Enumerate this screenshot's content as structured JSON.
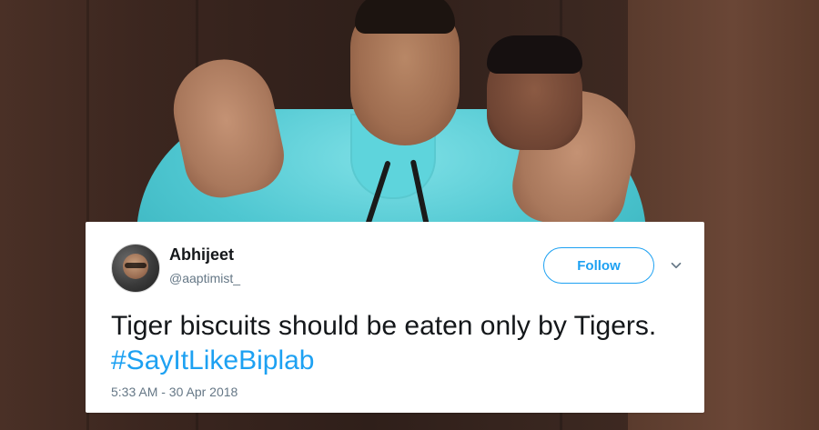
{
  "tweet": {
    "author_name": "Abhijeet",
    "author_handle": "@aaptimist_",
    "follow_label": "Follow",
    "text": "Tiger biscuits should be eaten only by Tigers.",
    "hashtag": "#SayItLikeBiplab",
    "timestamp": "5:33 AM - 30 Apr 2018"
  },
  "colors": {
    "twitter_blue": "#1da1f2",
    "text_dark": "#14171a",
    "text_gray": "#657786"
  },
  "icons": {
    "avatar": "user-avatar",
    "menu": "chevron-down-icon"
  }
}
